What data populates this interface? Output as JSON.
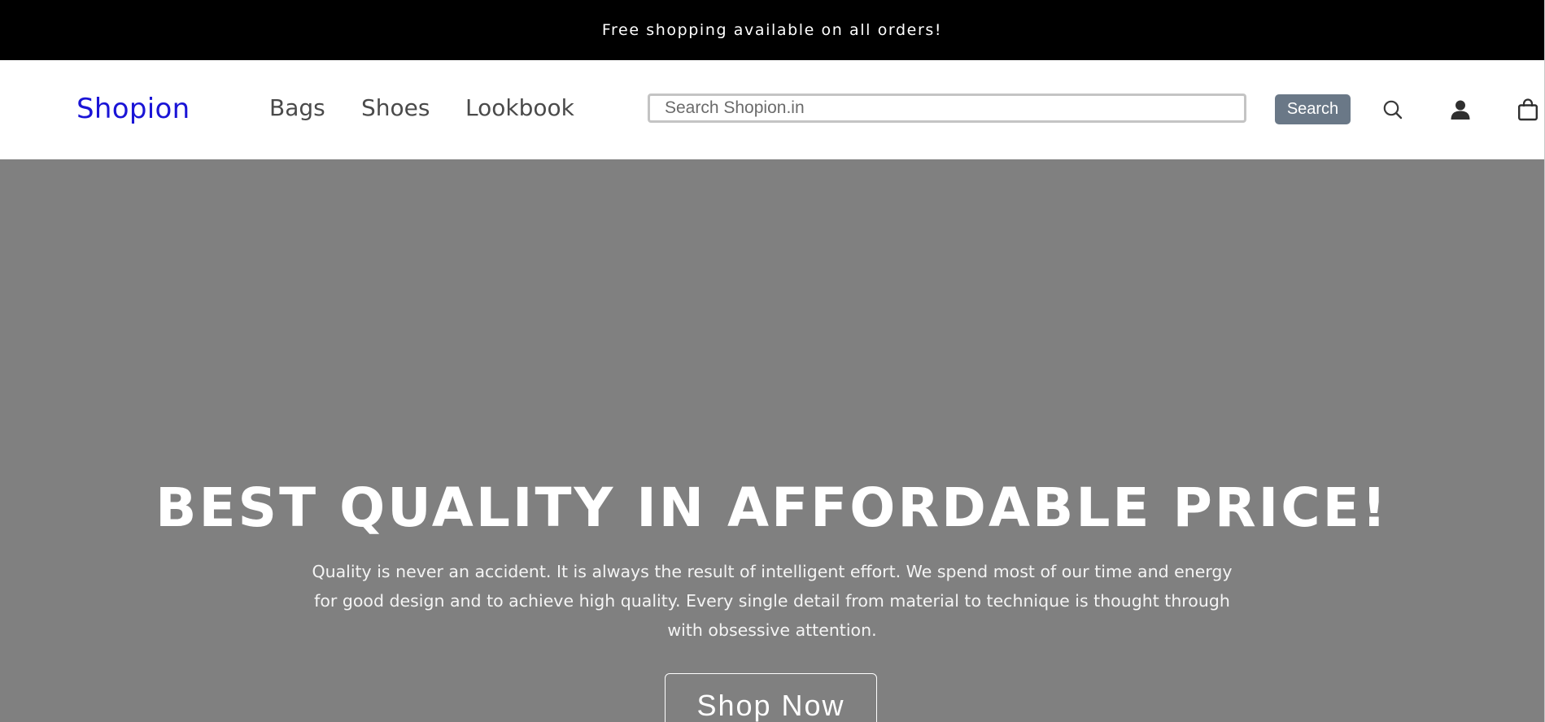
{
  "announcement": {
    "text": "Free shopping available on all orders!"
  },
  "header": {
    "logo": "Shopion",
    "nav": [
      {
        "label": "Bags"
      },
      {
        "label": "Shoes"
      },
      {
        "label": "Lookbook"
      }
    ],
    "search": {
      "placeholder": "Search Shopion.in",
      "value": "",
      "button_label": "Search"
    },
    "icons": [
      "search-icon",
      "account-icon",
      "shopping-bag-icon"
    ]
  },
  "hero": {
    "title": "BEST QUALITY IN AFFORDABLE PRICE!",
    "description": "Quality is never an accident. It is always the result of intelligent effort. We spend most of our time and energy for good design and to achieve high quality. Every single detail from material to technique is thought through with obsessive attention.",
    "cta_label": "Shop Now"
  },
  "colors": {
    "announcement_bg": "#000000",
    "logo": "#1a14d6",
    "nav_text": "#4a4a4a",
    "search_button_bg": "#6a7887",
    "hero_bg": "#808080",
    "hero_text": "#ffffff"
  }
}
